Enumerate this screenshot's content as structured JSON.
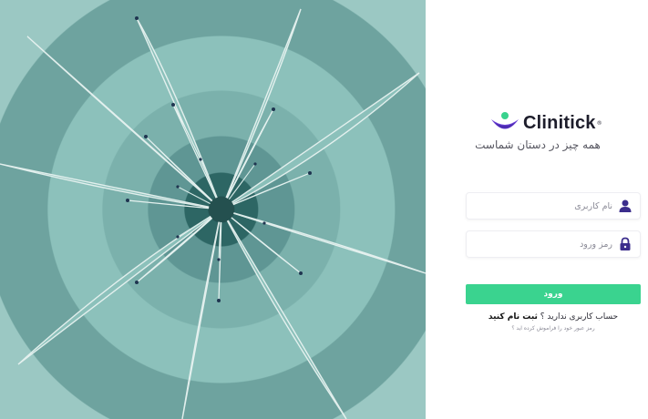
{
  "brand": {
    "name": "Clinitick",
    "mark": "®"
  },
  "tagline": "همه چیز در دستان شماست",
  "form": {
    "username_placeholder": "نام کاربری",
    "password_placeholder": "رمز ورود",
    "submit_label": "ورود"
  },
  "signup": {
    "prompt": "حساب کاربری ندارید ؟",
    "link": "ثبت نام کنید"
  },
  "forgot": {
    "link": "رمز عبور خود را فراموش کرده اید ؟"
  },
  "colors": {
    "primary": "#3ad38f",
    "icon": "#3b2d8c",
    "logo_purple": "#6b3fd6",
    "logo_green": "#39d28d"
  },
  "icons": {
    "username": "user-icon",
    "password": "lock-icon",
    "logo": "clinitick-logo-icon"
  }
}
